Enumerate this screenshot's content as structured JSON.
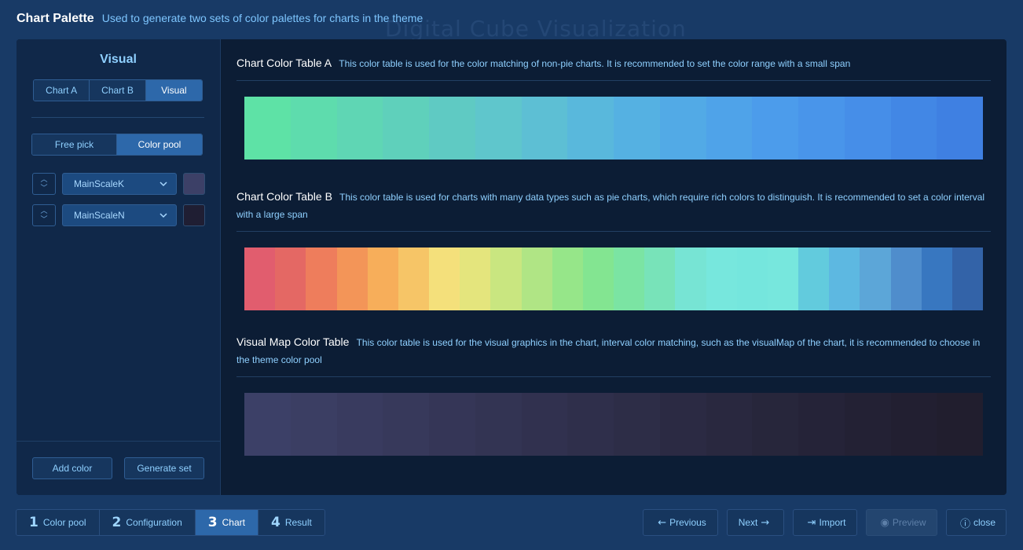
{
  "header": {
    "title": "Chart Palette",
    "subtitle": "Used to generate two sets of color palettes for charts in the theme"
  },
  "sidebar": {
    "title": "Visual",
    "tabs": [
      {
        "label": "Chart A",
        "active": false
      },
      {
        "label": "Chart B",
        "active": false
      },
      {
        "label": "Visual",
        "active": true
      }
    ],
    "modes": [
      {
        "label": "Free pick",
        "active": false
      },
      {
        "label": "Color pool",
        "active": true
      }
    ],
    "colors": [
      {
        "name": "MainScaleK",
        "swatch": "#3c4067"
      },
      {
        "name": "MainScaleN",
        "swatch": "#1f1e33"
      }
    ],
    "add_label": "Add color",
    "generate_label": "Generate set"
  },
  "sections": [
    {
      "title": "Chart Color Table A",
      "desc": "This color table is used for the color matching of non-pie charts. It is recommended to set the color range with a small span",
      "colors": [
        "#5ee2a6",
        "#5edcad",
        "#5fd6b4",
        "#5fd0bb",
        "#5fcac3",
        "#5fc6cc",
        "#5dbfd4",
        "#59b8dc",
        "#55b1e2",
        "#52aae6",
        "#4fa3e9",
        "#4c9ceb",
        "#4995ea",
        "#468ee8",
        "#4287e5",
        "#3f80e2"
      ]
    },
    {
      "title": "Chart Color Table B",
      "desc": "This color table is used for charts with many data types such as pie charts, which require rich colors to distinguish. It is recommended to set a color interval with a large span",
      "colors": [
        "#e15d6e",
        "#e46864",
        "#ee7d5c",
        "#f39558",
        "#f7ae5a",
        "#f6c567",
        "#f4e07b",
        "#e4e57d",
        "#c9e680",
        "#b0e585",
        "#96e689",
        "#83e591",
        "#7be4a3",
        "#78e3b9",
        "#77e4d4",
        "#77e7dd",
        "#75e6dd",
        "#77e7dd",
        "#62cbdd",
        "#5db8e1",
        "#5ca6d8",
        "#4f8dcc",
        "#3877c0",
        "#3363a8"
      ]
    },
    {
      "title": "Visual Map Color Table",
      "desc": "This color table is used for the visual graphics in the chart, interval color matching, such as the visualMap of the chart, it is recommended to choose in the theme color pool",
      "colors": [
        "#3c4067",
        "#3b3e63",
        "#393b5f",
        "#37395b",
        "#353657",
        "#333453",
        "#31314f",
        "#2f2f4b",
        "#2d2d47",
        "#2b2a43",
        "#29283f",
        "#27263b",
        "#252338",
        "#232134",
        "#221f31",
        "#211e2e"
      ]
    }
  ],
  "footer": {
    "steps": [
      {
        "num": "1",
        "label": "Color pool",
        "active": false
      },
      {
        "num": "2",
        "label": "Configuration",
        "active": false
      },
      {
        "num": "3",
        "label": "Chart",
        "active": true
      },
      {
        "num": "4",
        "label": "Result",
        "active": false
      }
    ],
    "previous_label": "Previous",
    "next_label": "Next",
    "import_label": "Import",
    "preview_label": "Preview",
    "close_label": "close"
  },
  "watermark": "Digital Cube Visualization"
}
